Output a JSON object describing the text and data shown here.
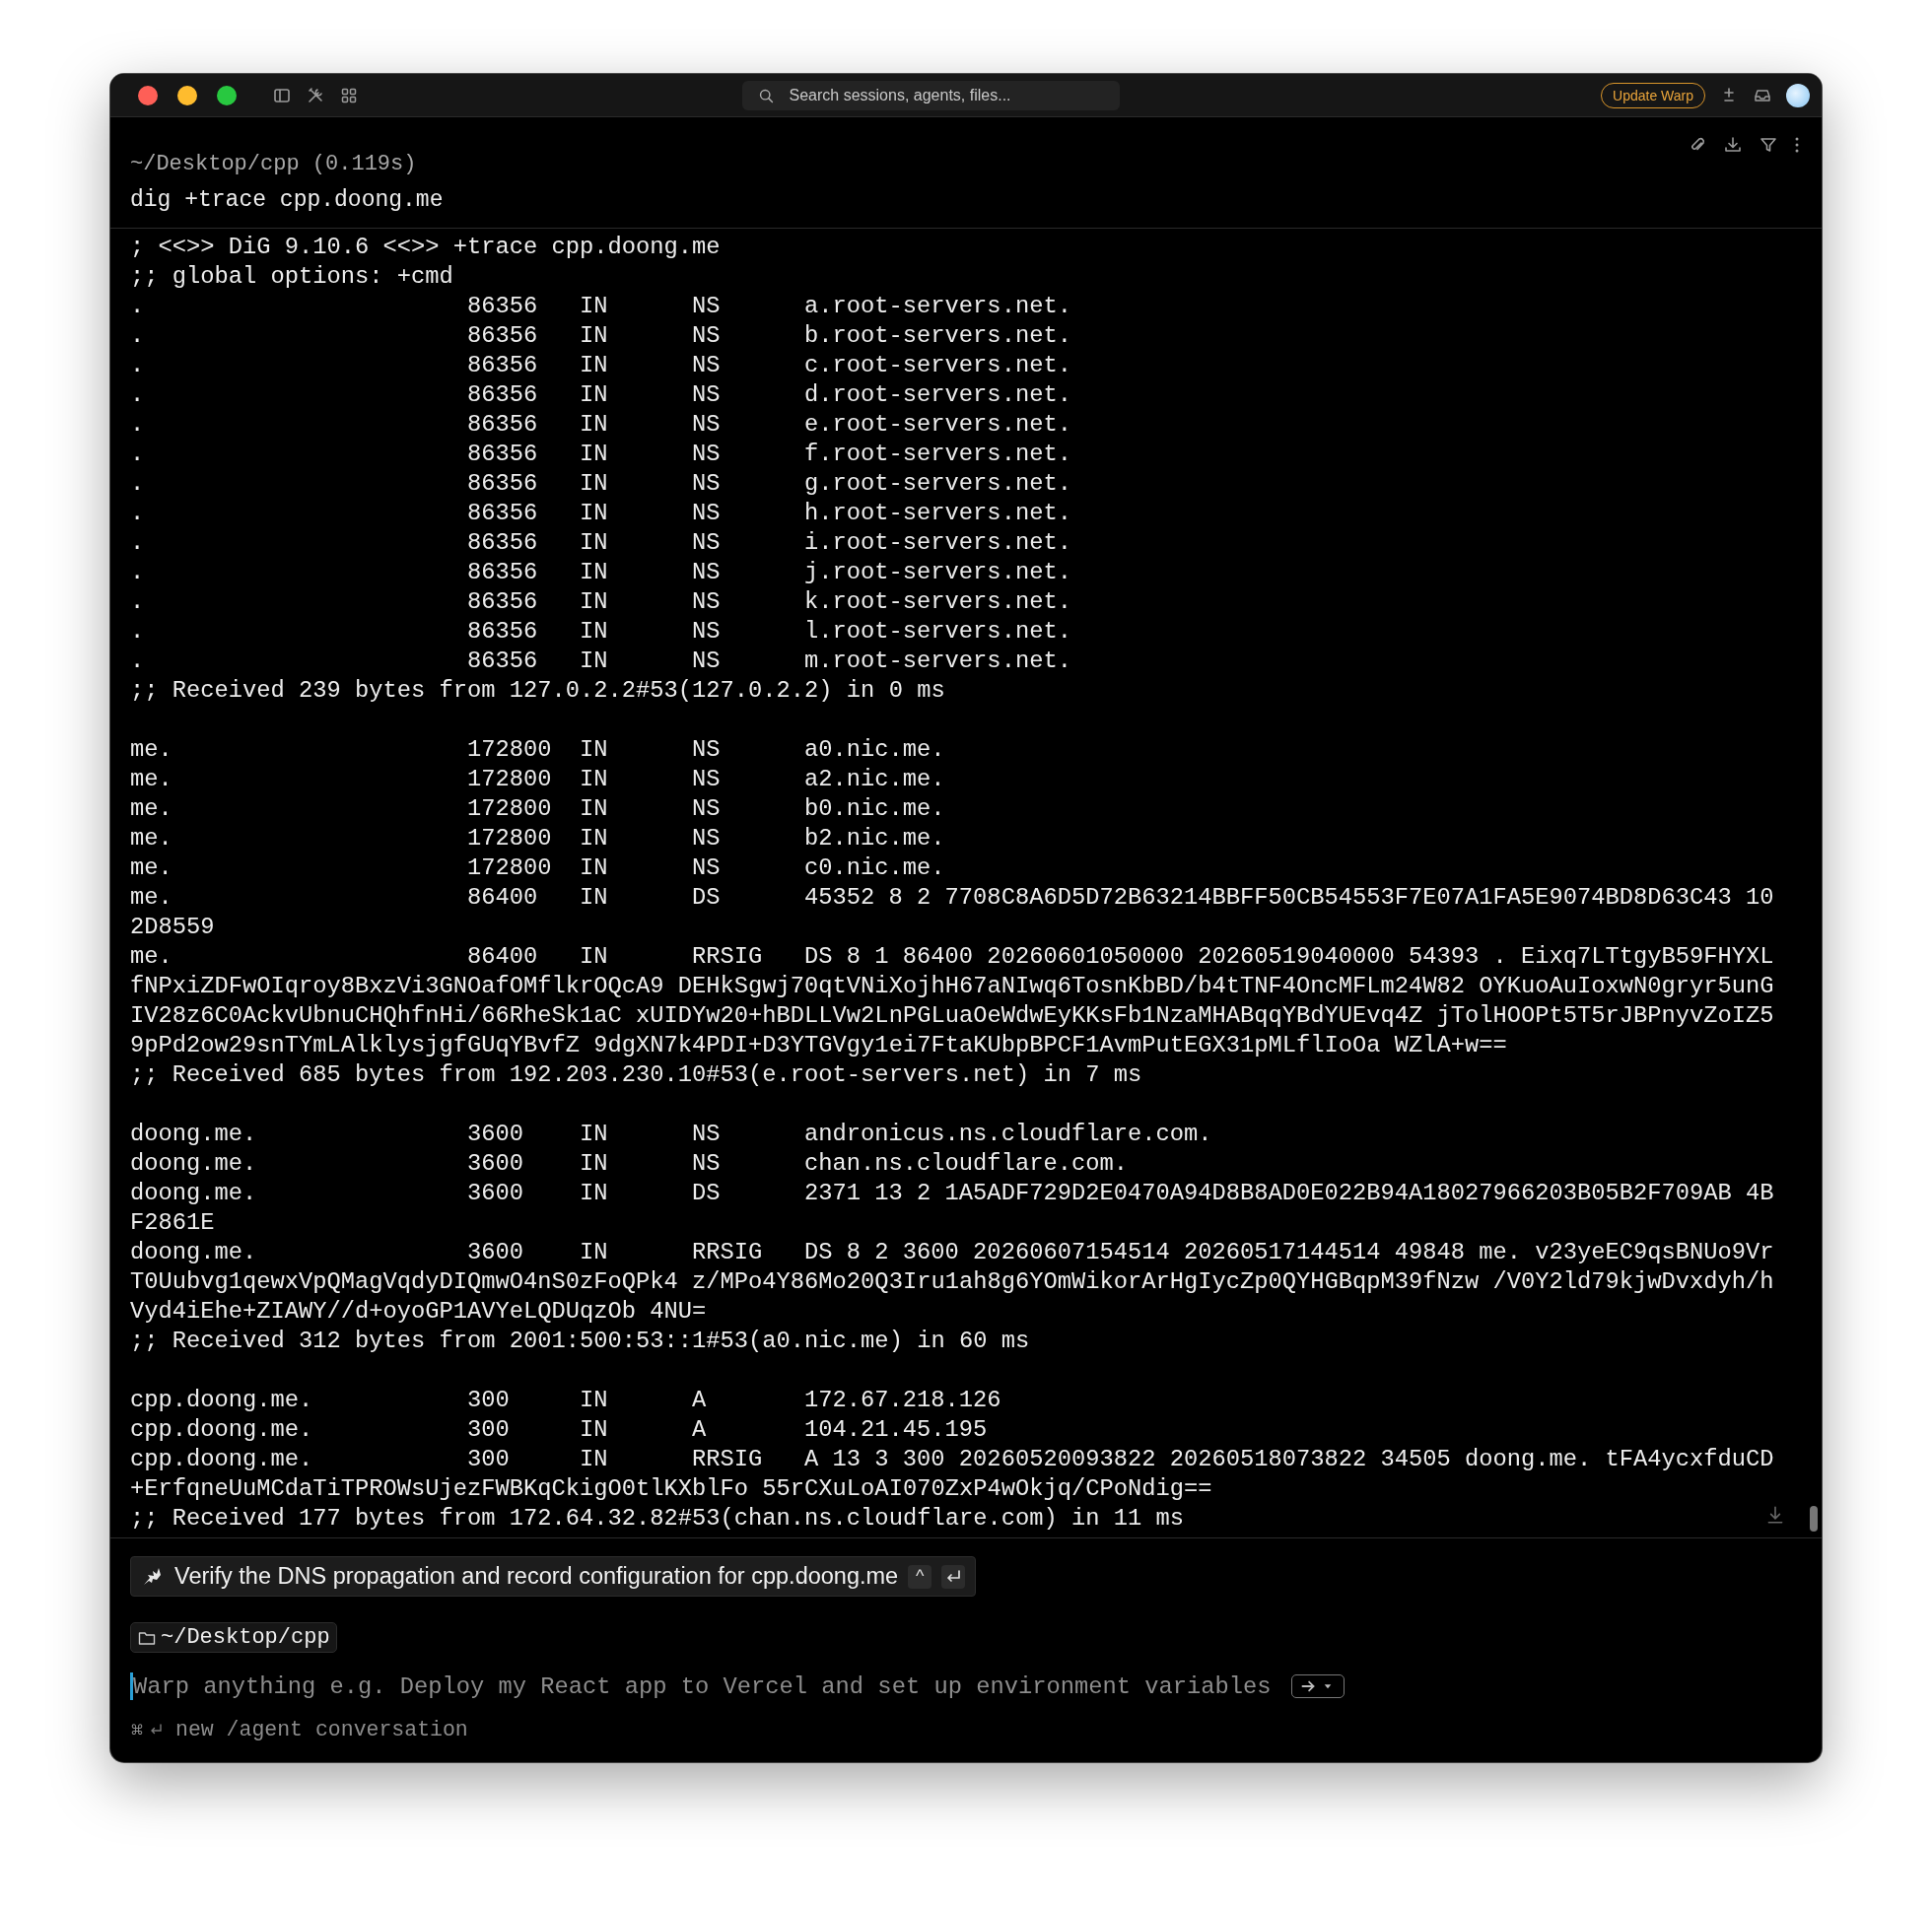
{
  "window": {
    "search_placeholder": "Search sessions, agents, files...",
    "update_button": "Update Warp"
  },
  "block": {
    "path": "~/Desktop/cpp (0.119s)",
    "command": "dig +trace cpp.doong.me",
    "output": [
      {
        "kind": "text",
        "text": "; <<>> DiG 9.10.6 <<>> +trace cpp.doong.me"
      },
      {
        "kind": "text",
        "text": ";; global options: +cmd"
      },
      {
        "kind": "record",
        "name": ".",
        "ttl": "86356",
        "class": "IN",
        "type": "NS",
        "data": [
          "a.root-servers.net."
        ]
      },
      {
        "kind": "record",
        "name": ".",
        "ttl": "86356",
        "class": "IN",
        "type": "NS",
        "data": [
          "b.root-servers.net."
        ]
      },
      {
        "kind": "record",
        "name": ".",
        "ttl": "86356",
        "class": "IN",
        "type": "NS",
        "data": [
          "c.root-servers.net."
        ]
      },
      {
        "kind": "record",
        "name": ".",
        "ttl": "86356",
        "class": "IN",
        "type": "NS",
        "data": [
          "d.root-servers.net."
        ]
      },
      {
        "kind": "record",
        "name": ".",
        "ttl": "86356",
        "class": "IN",
        "type": "NS",
        "data": [
          "e.root-servers.net."
        ]
      },
      {
        "kind": "record",
        "name": ".",
        "ttl": "86356",
        "class": "IN",
        "type": "NS",
        "data": [
          "f.root-servers.net."
        ]
      },
      {
        "kind": "record",
        "name": ".",
        "ttl": "86356",
        "class": "IN",
        "type": "NS",
        "data": [
          "g.root-servers.net."
        ]
      },
      {
        "kind": "record",
        "name": ".",
        "ttl": "86356",
        "class": "IN",
        "type": "NS",
        "data": [
          "h.root-servers.net."
        ]
      },
      {
        "kind": "record",
        "name": ".",
        "ttl": "86356",
        "class": "IN",
        "type": "NS",
        "data": [
          "i.root-servers.net."
        ]
      },
      {
        "kind": "record",
        "name": ".",
        "ttl": "86356",
        "class": "IN",
        "type": "NS",
        "data": [
          "j.root-servers.net."
        ]
      },
      {
        "kind": "record",
        "name": ".",
        "ttl": "86356",
        "class": "IN",
        "type": "NS",
        "data": [
          "k.root-servers.net."
        ]
      },
      {
        "kind": "record",
        "name": ".",
        "ttl": "86356",
        "class": "IN",
        "type": "NS",
        "data": [
          "l.root-servers.net."
        ]
      },
      {
        "kind": "record",
        "name": ".",
        "ttl": "86356",
        "class": "IN",
        "type": "NS",
        "data": [
          "m.root-servers.net."
        ]
      },
      {
        "kind": "text",
        "text": ";; Received 239 bytes from 127.0.2.2#53(127.0.2.2) in 0 ms"
      },
      {
        "kind": "blank"
      },
      {
        "kind": "record",
        "name": "me.",
        "ttl": "172800",
        "class": "IN",
        "type": "NS",
        "data": [
          "a0.nic.me."
        ]
      },
      {
        "kind": "record",
        "name": "me.",
        "ttl": "172800",
        "class": "IN",
        "type": "NS",
        "data": [
          "a2.nic.me."
        ]
      },
      {
        "kind": "record",
        "name": "me.",
        "ttl": "172800",
        "class": "IN",
        "type": "NS",
        "data": [
          "b0.nic.me."
        ]
      },
      {
        "kind": "record",
        "name": "me.",
        "ttl": "172800",
        "class": "IN",
        "type": "NS",
        "data": [
          "b2.nic.me."
        ]
      },
      {
        "kind": "record",
        "name": "me.",
        "ttl": "172800",
        "class": "IN",
        "type": "NS",
        "data": [
          "c0.nic.me."
        ]
      },
      {
        "kind": "record",
        "name": "me.",
        "ttl": "86400",
        "class": "IN",
        "type": "DS",
        "data": [
          "45352 8 2 7708C8A6D5D72B63214BBFF50CB54553F7E07A1FA5E9074BD8D63C43 10",
          "2D8559"
        ]
      },
      {
        "kind": "record",
        "name": "me.",
        "ttl": "86400",
        "class": "IN",
        "type": "RRSIG",
        "data": [
          "DS 8 1 86400 20260601050000 20260519040000 54393 . Eixq7LTtgyB59FHYXL",
          "fNPxiZDFwOIqroy8BxzVi3GNOafOMflkrOQcA9 DEHkSgwj70qtVNiXojhH67aNIwq6TosnKbBD/b4tTNF4OncMFLm24W82 OYKuoAuIoxwN0gryr5unG",
          "IV28z6C0AckvUbnuCHQhfnHi/66RheSk1aC xUIDYw20+hBDLLVw2LnPGLuaOeWdwEyKKsFb1NzaMHABqqYBdYUEvq4Z jTolHOOPt5T5rJBPnyvZoIZ5",
          "9pPd2ow29snTYmLAlklysjgfGUqYBvfZ 9dgXN7k4PDI+D3YTGVgy1ei7FtaKUbpBPCF1AvmPutEGX31pMLflIoOa WZlA+w=="
        ]
      },
      {
        "kind": "text",
        "text": ";; Received 685 bytes from 192.203.230.10#53(e.root-servers.net) in 7 ms"
      },
      {
        "kind": "blank"
      },
      {
        "kind": "record",
        "name": "doong.me.",
        "ttl": "3600",
        "class": "IN",
        "type": "NS",
        "data": [
          "andronicus.ns.cloudflare.com."
        ]
      },
      {
        "kind": "record",
        "name": "doong.me.",
        "ttl": "3600",
        "class": "IN",
        "type": "NS",
        "data": [
          "chan.ns.cloudflare.com."
        ]
      },
      {
        "kind": "record",
        "name": "doong.me.",
        "ttl": "3600",
        "class": "IN",
        "type": "DS",
        "data": [
          "2371 13 2 1A5ADF729D2E0470A94D8B8AD0E022B94A18027966203B05B2F709AB 4B",
          "F2861E"
        ]
      },
      {
        "kind": "record",
        "name": "doong.me.",
        "ttl": "3600",
        "class": "IN",
        "type": "RRSIG",
        "data": [
          "DS 8 2 3600 20260607154514 20260517144514 49848 me. v23yeEC9qsBNUo9Vr",
          "T0Uubvg1qewxVpQMagVqdyDIQmwO4nS0zFoQPk4 z/MPo4Y86Mo20Q3Iru1ah8g6YOmWikorArHgIycZp0QYHGBqpM39fNzw /V0Y2ld79kjwDvxdyh/h",
          "Vyd4iEhe+ZIAWY//d+oyoGP1AVYeLQDUqzOb 4NU="
        ]
      },
      {
        "kind": "text",
        "text": ";; Received 312 bytes from 2001:500:53::1#53(a0.nic.me) in 60 ms"
      },
      {
        "kind": "blank"
      },
      {
        "kind": "record",
        "name": "cpp.doong.me.",
        "ttl": "300",
        "class": "IN",
        "type": "A",
        "data": [
          "172.67.218.126"
        ]
      },
      {
        "kind": "record",
        "name": "cpp.doong.me.",
        "ttl": "300",
        "class": "IN",
        "type": "A",
        "data": [
          "104.21.45.195"
        ]
      },
      {
        "kind": "record",
        "name": "cpp.doong.me.",
        "ttl": "300",
        "class": "IN",
        "type": "RRSIG",
        "data": [
          "A 13 3 300 20260520093822 20260518073822 34505 doong.me. tFA4ycxfduCD",
          "+ErfqneUuMCdaTiTPROWsUjezFWBKqCkigO0tlKXblFo 55rCXuLoAI070ZxP4wOkjq/CPoNdig=="
        ]
      },
      {
        "kind": "text",
        "text": ";; Received 177 bytes from 172.64.32.82#53(chan.ns.cloudflare.com) in 11 ms"
      }
    ]
  },
  "suggestion": {
    "text": "Verify the DNS propagation and record configuration for cpp.doong.me",
    "key": "^"
  },
  "directory": "~/Desktop/cpp",
  "input": {
    "placeholder": "Warp anything e.g. Deploy my React app to Vercel and set up environment variables"
  },
  "hint": {
    "key": "⌘",
    "text": "new /agent conversation"
  }
}
